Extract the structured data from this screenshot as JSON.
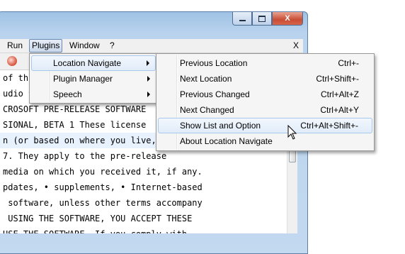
{
  "window": {
    "title_buttons": {
      "minimize": "",
      "maximize": "",
      "close": "X"
    }
  },
  "menubar": {
    "items": [
      "Run",
      "Plugins",
      "Window",
      "?"
    ],
    "active": "Plugins",
    "close_label": "X"
  },
  "editor": {
    "lines": [
      "of th",
      "udio 9.0, Beta 1 license agr",
      "CROSOFT PRE-RELEASE SOFTWARE",
      "SIONAL, BETA 1 These license",
      "n (or based on where you live, one of",
      "7. They apply to the pre-release",
      "media on which you received it, if any.",
      "pdates, • supplements, • Internet-based",
      " software, unless other terms accompany",
      " USING THE SOFTWARE, YOU ACCEPT THESE",
      "USE THE SOFTWARE. If you comply with"
    ]
  },
  "plugins_menu": {
    "items": [
      {
        "label": "Location Navigate",
        "has_submenu": true
      },
      {
        "label": "Plugin Manager",
        "has_submenu": true
      },
      {
        "label": "Speech",
        "has_submenu": true
      }
    ]
  },
  "location_navigate_menu": {
    "items": [
      {
        "label": "Previous Location",
        "shortcut": "Ctrl+-"
      },
      {
        "label": "Next Location",
        "shortcut": "Ctrl+Shift+-"
      },
      {
        "label": "Previous Changed",
        "shortcut": "Ctrl+Alt+Z"
      },
      {
        "label": "Next Changed",
        "shortcut": "Ctrl+Alt+Y"
      },
      {
        "label": "Show List and Option",
        "shortcut": "Ctrl+Alt+Shift+-"
      },
      {
        "label": "About Location Navigate",
        "shortcut": ""
      }
    ]
  }
}
